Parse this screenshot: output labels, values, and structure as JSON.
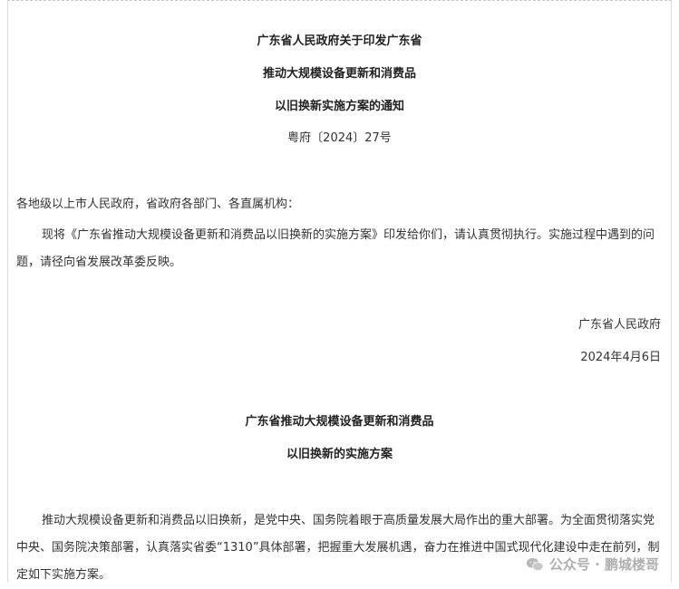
{
  "doc": {
    "title1": "广东省人民政府关于印发广东省",
    "title2": "推动大规模设备更新和消费品",
    "title3": "以旧换新实施方案的通知",
    "doc_no": "粤府〔2024〕27号",
    "recipients": "各地级以上市人民政府，省政府各部门、各直属机构：",
    "body_para": "现将《广东省推动大规模设备更新和消费品以旧换新的实施方案》印发给你们，请认真贯彻执行。实施过程中遇到的问题，请径向省发展改革委反映。",
    "issuer": "广东省人民政府",
    "date": "2024年4月6日",
    "plan_title1": "广东省推动大规模设备更新和消费品",
    "plan_title2": "以旧换新的实施方案",
    "plan_para": "推动大规模设备更新和消费品以旧换新，是党中央、国务院着眼于高质量发展大局作出的重大部署。为全面贯彻落实党中央、国务院决策部署，认真落实省委“1310”具体部署，把握重大发展机遇，奋力在推进中国式现代化建设中走在前列，制定如下实施方案。"
  },
  "watermark": {
    "text": "公众号 · 鹏城楼哥",
    "icon": "wechat-icon"
  }
}
